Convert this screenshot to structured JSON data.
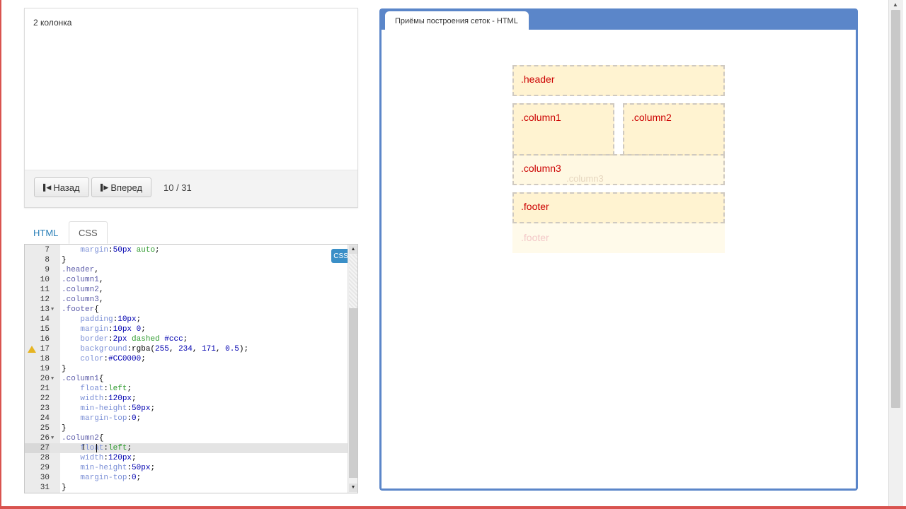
{
  "lesson": {
    "step_title": "2 колонка",
    "back_label": "Назад",
    "forward_label": "Вперед",
    "counter": "10 / 31"
  },
  "editor_tabs": [
    {
      "label": "HTML",
      "active": false
    },
    {
      "label": "CSS",
      "active": true
    }
  ],
  "editor": {
    "badge": "CSS",
    "active_line": 27,
    "warning_line": 17,
    "lines": [
      {
        "n": "7",
        "tokens": [
          [
            "    ",
            ""
          ],
          [
            "margin",
            "prop"
          ],
          [
            ":",
            ""
          ],
          [
            "50px",
            "num"
          ],
          [
            " ",
            ""
          ],
          [
            "auto",
            "kw"
          ],
          [
            ";",
            ""
          ]
        ]
      },
      {
        "n": "8",
        "tokens": [
          [
            "}",
            ""
          ]
        ]
      },
      {
        "n": "9",
        "tokens": [
          [
            ".header",
            "sel"
          ],
          [
            ",",
            ""
          ]
        ]
      },
      {
        "n": "10",
        "tokens": [
          [
            ".column1",
            "sel"
          ],
          [
            ",",
            ""
          ]
        ]
      },
      {
        "n": "11",
        "tokens": [
          [
            ".column2",
            "sel"
          ],
          [
            ",",
            ""
          ]
        ]
      },
      {
        "n": "12",
        "tokens": [
          [
            ".column3",
            "sel"
          ],
          [
            ",",
            ""
          ]
        ]
      },
      {
        "n": "13",
        "fold": true,
        "tokens": [
          [
            ".footer",
            "sel"
          ],
          [
            "{",
            ""
          ]
        ]
      },
      {
        "n": "14",
        "tokens": [
          [
            "    ",
            ""
          ],
          [
            "padding",
            "prop"
          ],
          [
            ":",
            ""
          ],
          [
            "10px",
            "num"
          ],
          [
            ";",
            ""
          ]
        ]
      },
      {
        "n": "15",
        "tokens": [
          [
            "    ",
            ""
          ],
          [
            "margin",
            "prop"
          ],
          [
            ":",
            ""
          ],
          [
            "10px",
            "num"
          ],
          [
            " ",
            ""
          ],
          [
            "0",
            "num"
          ],
          [
            ";",
            ""
          ]
        ]
      },
      {
        "n": "16",
        "tokens": [
          [
            "    ",
            ""
          ],
          [
            "border",
            "prop"
          ],
          [
            ":",
            ""
          ],
          [
            "2px",
            "num"
          ],
          [
            " ",
            ""
          ],
          [
            "dashed",
            "kw"
          ],
          [
            " ",
            ""
          ],
          [
            "#ccc",
            "col"
          ],
          [
            ";",
            ""
          ]
        ]
      },
      {
        "n": "17",
        "warn": true,
        "tokens": [
          [
            "    ",
            ""
          ],
          [
            "background",
            "prop"
          ],
          [
            ":",
            ""
          ],
          [
            "rgba(",
            "fn"
          ],
          [
            "255",
            "num"
          ],
          [
            ", ",
            ""
          ],
          [
            "234",
            "num"
          ],
          [
            ", ",
            ""
          ],
          [
            "171",
            "num"
          ],
          [
            ", ",
            ""
          ],
          [
            "0.5",
            "num"
          ],
          [
            ");",
            ""
          ]
        ]
      },
      {
        "n": "18",
        "tokens": [
          [
            "    ",
            ""
          ],
          [
            "color",
            "prop"
          ],
          [
            ":",
            ""
          ],
          [
            "#CC0000",
            "col"
          ],
          [
            ";",
            ""
          ]
        ]
      },
      {
        "n": "19",
        "tokens": [
          [
            "}",
            ""
          ]
        ]
      },
      {
        "n": "20",
        "fold": true,
        "tokens": [
          [
            ".column1",
            "sel"
          ],
          [
            "{",
            ""
          ]
        ]
      },
      {
        "n": "21",
        "tokens": [
          [
            "    ",
            ""
          ],
          [
            "float",
            "prop"
          ],
          [
            ":",
            ""
          ],
          [
            "left",
            "kw"
          ],
          [
            ";",
            ""
          ]
        ]
      },
      {
        "n": "22",
        "tokens": [
          [
            "    ",
            ""
          ],
          [
            "width",
            "prop"
          ],
          [
            ":",
            ""
          ],
          [
            "120px",
            "num"
          ],
          [
            ";",
            ""
          ]
        ]
      },
      {
        "n": "23",
        "tokens": [
          [
            "    ",
            ""
          ],
          [
            "min-height",
            "prop"
          ],
          [
            ":",
            ""
          ],
          [
            "50px",
            "num"
          ],
          [
            ";",
            ""
          ]
        ]
      },
      {
        "n": "24",
        "tokens": [
          [
            "    ",
            ""
          ],
          [
            "margin-top",
            "prop"
          ],
          [
            ":",
            ""
          ],
          [
            "0",
            "num"
          ],
          [
            ";",
            ""
          ]
        ]
      },
      {
        "n": "25",
        "tokens": [
          [
            "}",
            ""
          ]
        ]
      },
      {
        "n": "26",
        "fold": true,
        "tokens": [
          [
            ".column2",
            "sel"
          ],
          [
            "{",
            ""
          ]
        ]
      },
      {
        "n": "27",
        "tokens": [
          [
            "    ",
            ""
          ],
          [
            "float",
            "prop"
          ],
          [
            ":",
            ""
          ],
          [
            "left",
            "kw"
          ],
          [
            ";",
            ""
          ]
        ]
      },
      {
        "n": "28",
        "tokens": [
          [
            "    ",
            ""
          ],
          [
            "width",
            "prop"
          ],
          [
            ":",
            ""
          ],
          [
            "120px",
            "num"
          ],
          [
            ";",
            ""
          ]
        ]
      },
      {
        "n": "29",
        "tokens": [
          [
            "    ",
            ""
          ],
          [
            "min-height",
            "prop"
          ],
          [
            ":",
            ""
          ],
          [
            "50px",
            "num"
          ],
          [
            ";",
            ""
          ]
        ]
      },
      {
        "n": "30",
        "tokens": [
          [
            "    ",
            ""
          ],
          [
            "margin-top",
            "prop"
          ],
          [
            ":",
            ""
          ],
          [
            "0",
            "num"
          ],
          [
            ";",
            ""
          ]
        ]
      },
      {
        "n": "31",
        "tokens": [
          [
            "}",
            ""
          ]
        ]
      }
    ]
  },
  "preview": {
    "tab_title": "Приёмы построения сеток - HTML",
    "blocks": {
      "header": ".header",
      "column1": ".column1",
      "column2": ".column2",
      "column3": ".column3",
      "footer": ".footer",
      "ghost_column": ".column3",
      "ghost_footer": ".footer"
    }
  },
  "colors": {
    "accent_blue": "#5b86c9",
    "block_text": "#cc0000",
    "block_bg": "rgba(255,234,171,0.5)",
    "frame_red": "#d9534f"
  }
}
